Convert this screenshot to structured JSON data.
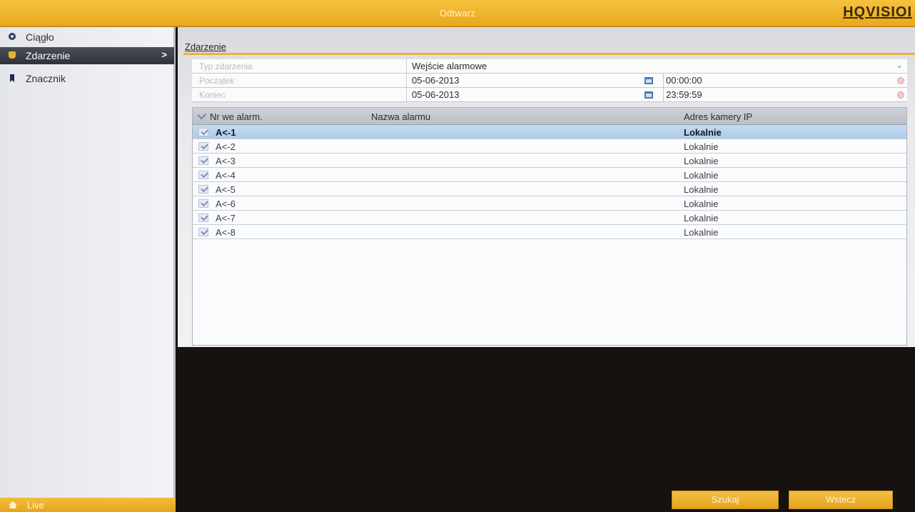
{
  "header": {
    "title": "Odtwarz",
    "brand": "HQVISIOI"
  },
  "sidebar": {
    "items": [
      {
        "label": "Ciągło",
        "icon": "circle-icon"
      },
      {
        "label": "Zdarzenie",
        "icon": "mic-icon",
        "arrow": ">"
      },
      {
        "label": "Znacznik",
        "icon": "bookmark-icon"
      }
    ],
    "live": "Live"
  },
  "main": {
    "tab": "Zdarzenie",
    "form": {
      "type_label": "Typ zdarzenia",
      "type_value": "Wejście alarmowe",
      "start_label": "Początek",
      "start_date": "05-06-2013",
      "start_time": "00:00:00",
      "end_label": "Koniec",
      "end_date": "05-06-2013",
      "end_time": "23:59:59"
    },
    "table": {
      "headers": [
        "Nr we alarm.",
        "Nazwa alarmu",
        "Adres kamery IP"
      ],
      "rows": [
        {
          "nr": "A<-1",
          "name": "",
          "addr": "Lokalnie"
        },
        {
          "nr": "A<-2",
          "name": "",
          "addr": "Lokalnie"
        },
        {
          "nr": "A<-3",
          "name": "",
          "addr": "Lokalnie"
        },
        {
          "nr": "A<-4",
          "name": "",
          "addr": "Lokalnie"
        },
        {
          "nr": "A<-5",
          "name": "",
          "addr": "Lokalnie"
        },
        {
          "nr": "A<-6",
          "name": "",
          "addr": "Lokalnie"
        },
        {
          "nr": "A<-7",
          "name": "",
          "addr": "Lokalnie"
        },
        {
          "nr": "A<-8",
          "name": "",
          "addr": "Lokalnie"
        }
      ]
    },
    "buttons": {
      "search": "Szukaj",
      "back": "Wstecz"
    }
  },
  "colors": {
    "accent": "#f0b630",
    "selection": "#b9d3ee",
    "sidebar_active": "#3c4047"
  }
}
